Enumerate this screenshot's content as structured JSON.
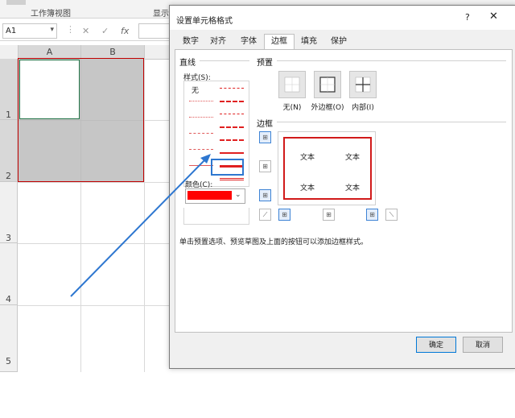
{
  "ribbon": {
    "group_view": "工作簿视图",
    "group_show": "显示"
  },
  "formula_bar": {
    "name_box": "A1",
    "fx_label": "fx"
  },
  "sheet": {
    "columns": [
      "A",
      "B"
    ],
    "rows": [
      "1",
      "2",
      "3",
      "4",
      "5"
    ]
  },
  "dialog": {
    "title": "设置单元格格式",
    "help": "?",
    "close": "✕",
    "tabs": [
      "数字",
      "对齐",
      "字体",
      "边框",
      "填充",
      "保护"
    ],
    "active_tab": "边框",
    "line_section": "直线",
    "style_label": "样式(S):",
    "none_label": "无",
    "color_label": "颜色(C):",
    "color_value": "#ff0000",
    "preset_section": "预置",
    "presets": [
      "无(N)",
      "外边框(O)",
      "内部(I)"
    ],
    "border_section": "边框",
    "preview_text": [
      "文本",
      "文本",
      "文本",
      "文本"
    ],
    "hint": "单击预置选项、预览草图及上面的按钮可以添加边框样式。",
    "ok": "确定",
    "cancel": "取消"
  },
  "colors": {
    "accent": "#2e77d0",
    "border_red": "#d11a1a",
    "excel_green": "#217346"
  }
}
